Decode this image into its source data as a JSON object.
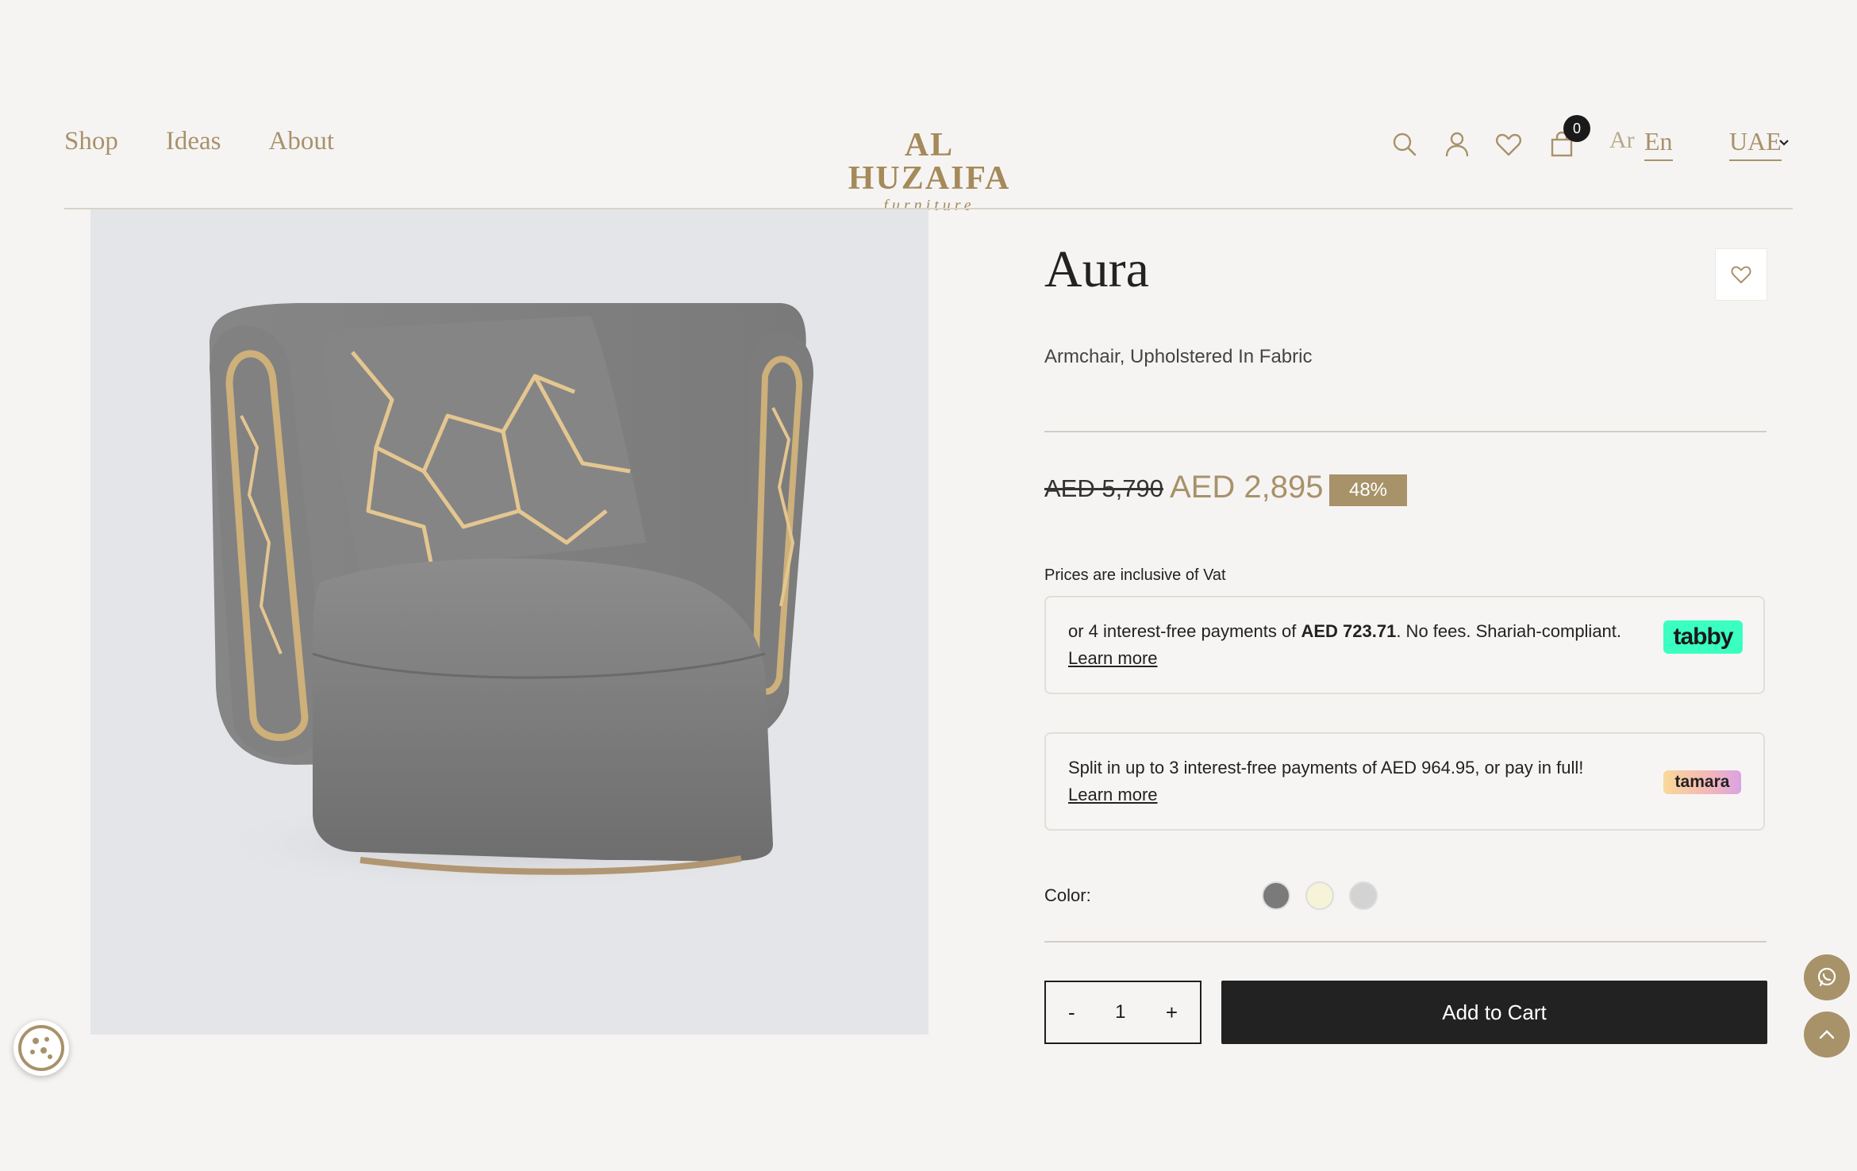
{
  "nav": {
    "shop": "Shop",
    "ideas": "Ideas",
    "about": "About"
  },
  "logo": {
    "main": "AL HUZAIFA",
    "sub": "furniture"
  },
  "header": {
    "cart_count": "0",
    "lang_ar": "Ar",
    "lang_en": "En",
    "region": "UAE"
  },
  "product": {
    "title": "Aura",
    "subtitle": "Armchair, Upholstered In Fabric",
    "old_price": "AED 5,790",
    "new_price": "AED 2,895",
    "discount": "48%",
    "vat_note": "Prices are inclusive of Vat"
  },
  "tabby": {
    "text_before": "or 4 interest-free payments of ",
    "amount": "AED 723.71",
    "text_after": ". No fees. Shariah-compliant.",
    "learn_more": "Learn more",
    "logo_text": "tabby"
  },
  "tamara": {
    "text": "Split in up to 3 interest-free payments of AED 964.95, or pay in full! ",
    "learn_more": "Learn more",
    "logo_text": "tamara"
  },
  "color": {
    "label": "Color:",
    "options": [
      "#7a7a7a",
      "#f6f3d8",
      "#d3d3d3"
    ]
  },
  "cart": {
    "minus": "-",
    "quantity": "1",
    "plus": "+",
    "add_label": "Add to Cart"
  },
  "colors": {
    "accent": "#a8926a",
    "background": "#f6f4f3",
    "dark": "#222222"
  }
}
